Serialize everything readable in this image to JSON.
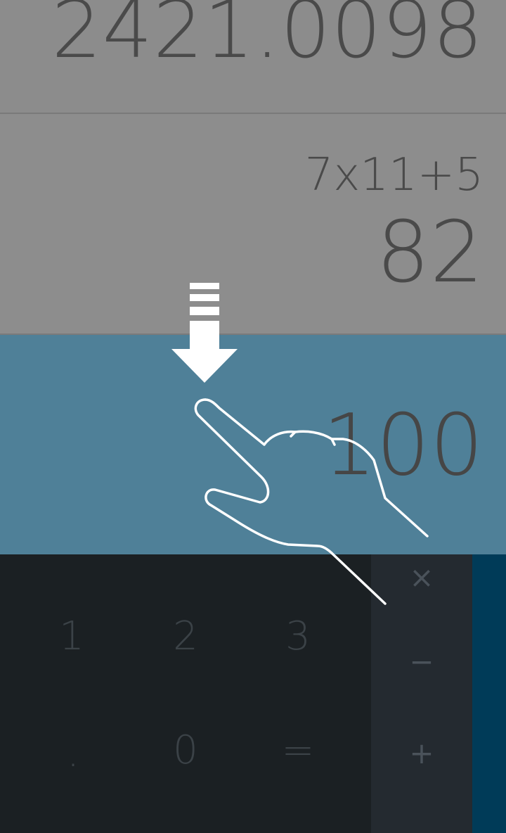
{
  "history": {
    "top_value": "2421.0098",
    "entry_expression": "7x11+5",
    "entry_result": "82"
  },
  "display": {
    "current_value": "100"
  },
  "numpad": {
    "keys": [
      "1",
      "2",
      "3",
      ".",
      "0",
      "="
    ]
  },
  "operators": {
    "multiply": "×",
    "minus": "−",
    "plus": "+"
  },
  "colors": {
    "history_bg": "#8c8c8c",
    "display_bg": "#4f8098",
    "numpad_bg": "#1b2023",
    "operator_bg": "#242a30",
    "advanced_panel": "#003b58"
  },
  "overlay": {
    "gesture": "swipe-down-hand-icon"
  }
}
